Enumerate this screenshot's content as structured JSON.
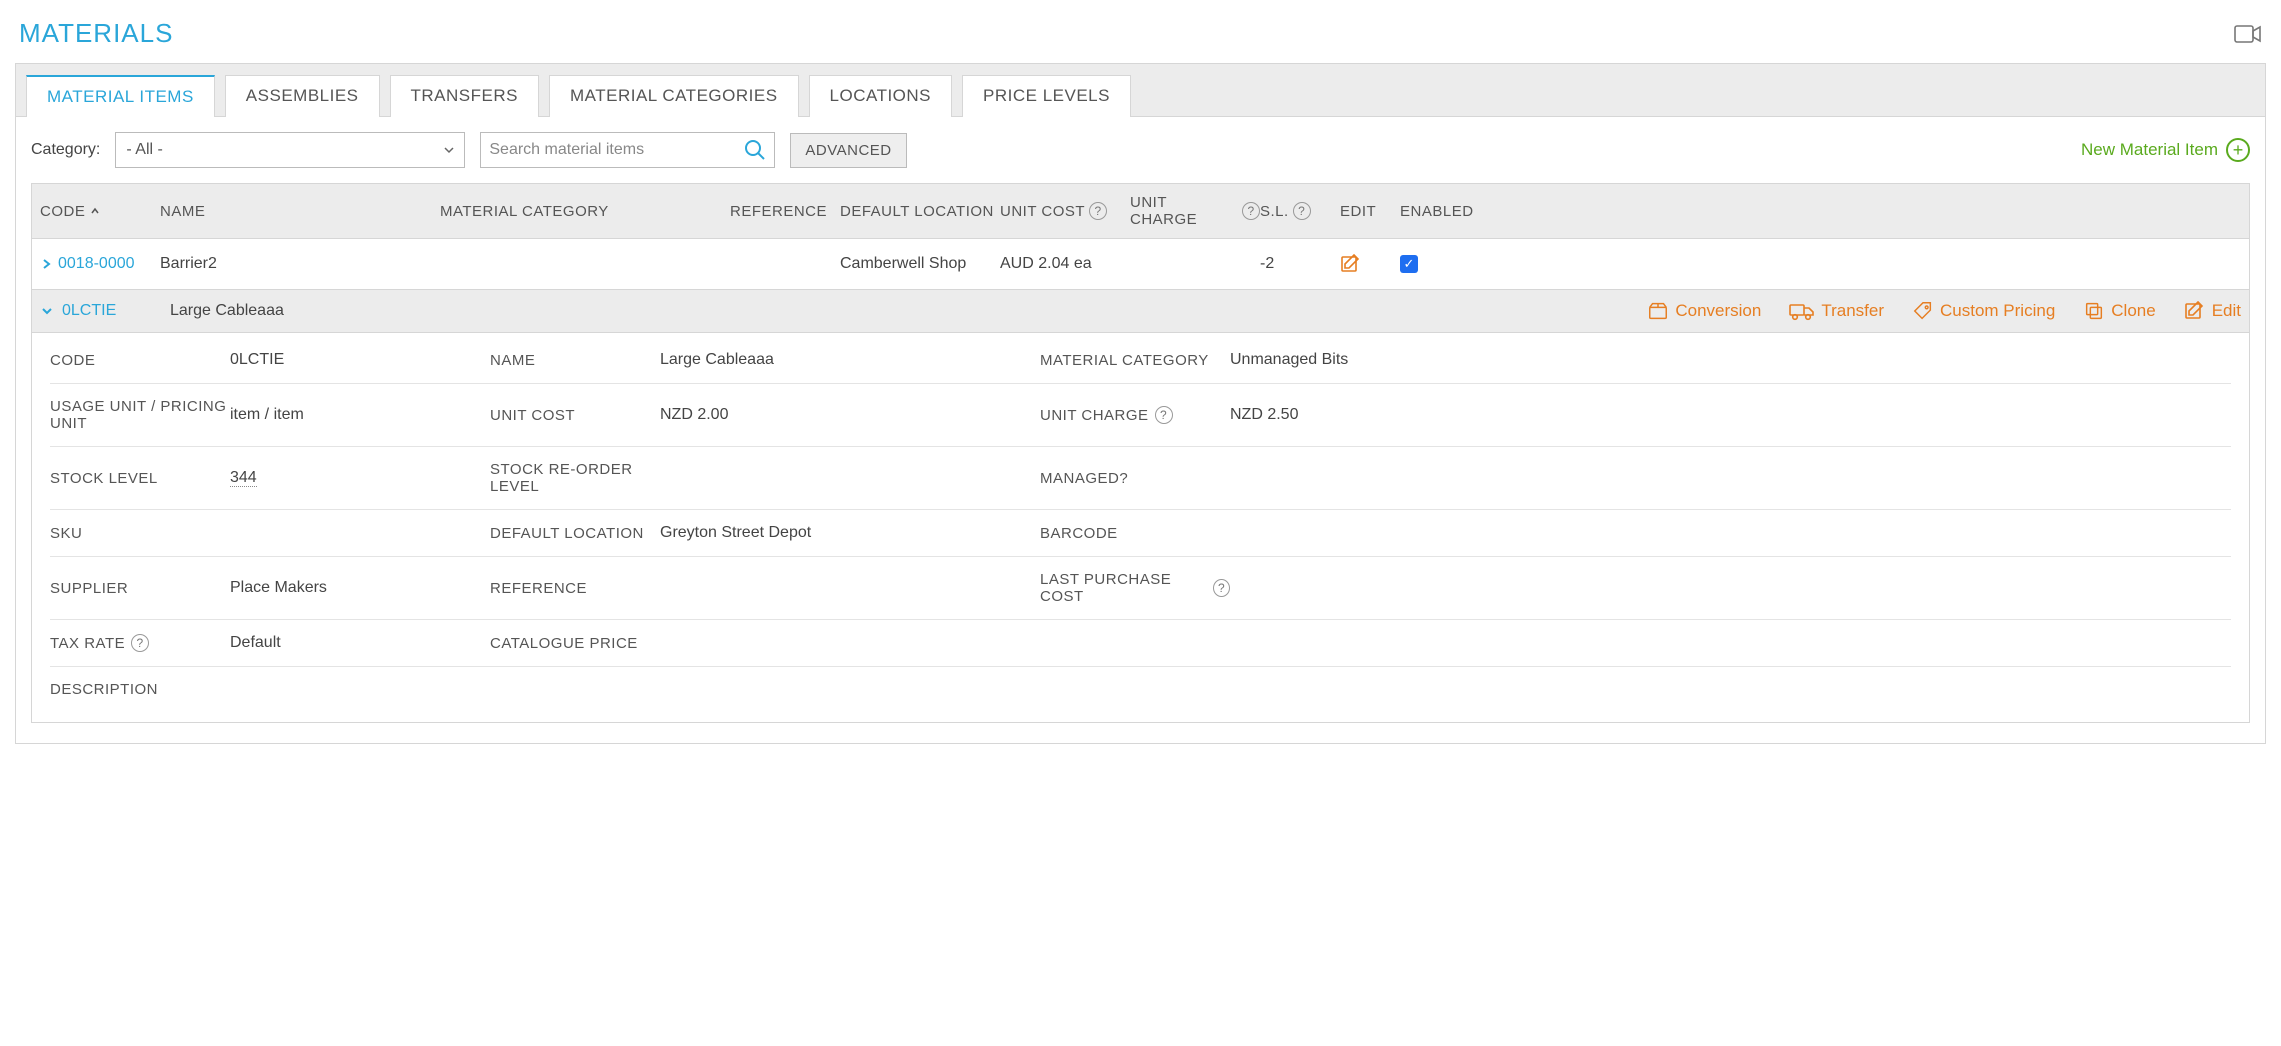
{
  "header": {
    "title": "MATERIALS"
  },
  "tabs": [
    "MATERIAL ITEMS",
    "ASSEMBLIES",
    "TRANSFERS",
    "MATERIAL CATEGORIES",
    "LOCATIONS",
    "PRICE LEVELS"
  ],
  "toolbar": {
    "category_label": "Category:",
    "category_value": "- All -",
    "search_placeholder": "Search material items",
    "advanced": "ADVANCED",
    "new_item": "New Material Item"
  },
  "columns": {
    "code": "CODE",
    "name": "NAME",
    "matcat": "MATERIAL CATEGORY",
    "reference": "REFERENCE",
    "defloc": "DEFAULT LOCATION",
    "unitcost": "UNIT COST",
    "unitcharge": "UNIT CHARGE",
    "sl": "S.L.",
    "edit": "EDIT",
    "enabled": "ENABLED"
  },
  "rows": [
    {
      "code": "0018-0000",
      "name": "Barrier2",
      "matcat": "",
      "reference": "",
      "defloc": "Camberwell Shop",
      "unitcost": "AUD 2.04 ea",
      "unitcharge": "",
      "sl": "-2",
      "enabled": true
    }
  ],
  "expanded": {
    "code": "0LCTIE",
    "name": "Large Cableaaa",
    "actions": {
      "conversion": "Conversion",
      "transfer": "Transfer",
      "custom_pricing": "Custom Pricing",
      "clone": "Clone",
      "edit": "Edit"
    },
    "details": {
      "code_label": "CODE",
      "code_val": "0LCTIE",
      "name_label": "NAME",
      "name_val": "Large Cableaaa",
      "matcat_label": "MATERIAL CATEGORY",
      "matcat_val": "Unmanaged Bits",
      "usage_label": "USAGE UNIT / PRICING UNIT",
      "usage_val": "item / item",
      "unitcost_label": "UNIT COST",
      "unitcost_val": "NZD 2.00",
      "unitcharge_label": "UNIT CHARGE",
      "unitcharge_val": "NZD 2.50",
      "stock_label": "STOCK LEVEL",
      "stock_val": "344",
      "reorder_label": "STOCK RE-ORDER LEVEL",
      "reorder_val": "",
      "managed_label": "MANAGED?",
      "managed_val": "",
      "sku_label": "SKU",
      "sku_val": "",
      "defloc_label": "DEFAULT LOCATION",
      "defloc_val": "Greyton Street Depot",
      "barcode_label": "BARCODE",
      "barcode_val": "",
      "supplier_label": "SUPPLIER",
      "supplier_val": "Place Makers",
      "reference_label": "REFERENCE",
      "reference_val": "",
      "lastpurch_label": "LAST PURCHASE COST",
      "lastpurch_val": "",
      "tax_label": "TAX RATE",
      "tax_val": "Default",
      "catprice_label": "CATALOGUE PRICE",
      "catprice_val": "",
      "desc_label": "DESCRIPTION",
      "desc_val": ""
    }
  }
}
